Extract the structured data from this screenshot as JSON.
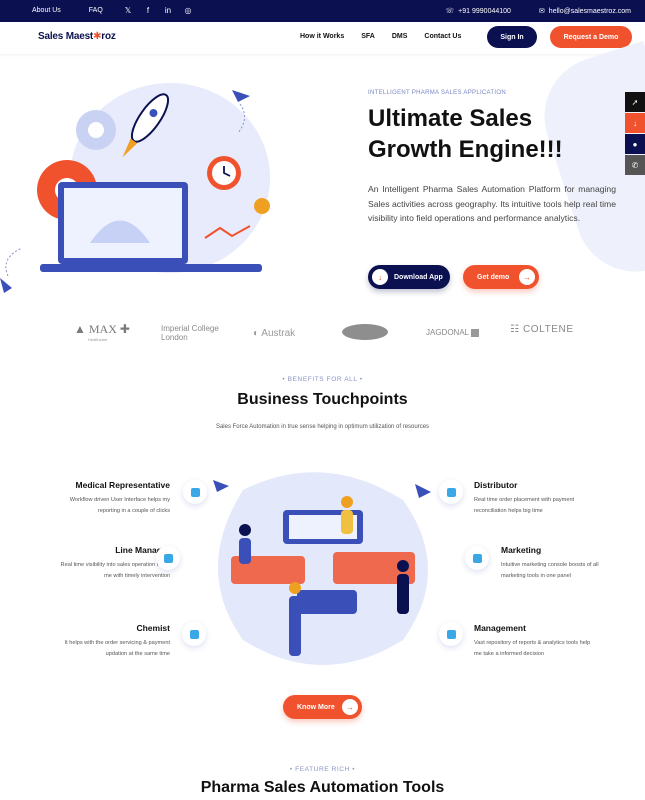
{
  "topbar": {
    "about": "About Us",
    "faq": "FAQ",
    "social": [
      "twitter-icon",
      "facebook-icon",
      "linkedin-icon",
      "instagram-icon"
    ],
    "social_glyphs": [
      "𝕏",
      "f",
      "in",
      "◎"
    ],
    "phone": "+91 9990044100",
    "email": "hello@salesmaestroz.com"
  },
  "nav": {
    "logo_text_1": "Sales Maest",
    "logo_star": "✱",
    "logo_text_2": "roz",
    "links": [
      "How it Works",
      "SFA",
      "DMS",
      "Contact Us"
    ],
    "signin": "Sign In",
    "demo": "Request a Demo"
  },
  "hero": {
    "eyebrow": "INTELLIGENT PHARMA SALES APPLICATION",
    "title": "Ultimate Sales Growth Engine!!!",
    "description": "An Intelligent Pharma Sales Automation Platform for managing Sales activities across geography. Its intuitive tools help real time visibility into field operations and performance analytics.",
    "download_btn": "Download App",
    "getdemo_btn": "Get demo"
  },
  "logos": {
    "max": "MAX",
    "max_sub": "Healthcare",
    "imperial": "Imperial College London",
    "austrak": "Austrak",
    "jagdonal": "JAGDONAL",
    "coltene": "COLTENE"
  },
  "benefits": {
    "eyebrow": "BENEFITS FOR ALL",
    "title": "Business Touchpoints",
    "subtitle": "Sales Force Automation in true sense helping in optimum utilization of resources",
    "items_left": [
      {
        "title": "Medical Representative",
        "desc": "Workflow driven User Interface helps my reporting in a couple of clicks"
      },
      {
        "title": "Line Manager",
        "desc": "Real time visibility into sales operation helps me with timely intervention"
      },
      {
        "title": "Chemist",
        "desc": "It helps with the order servicing & payment updation at the same time"
      }
    ],
    "items_right": [
      {
        "title": "Distributor",
        "desc": "Real time order placement with payment reconciliation helps big time"
      },
      {
        "title": "Marketing",
        "desc": "Intuitive marketing console boosts of all marketing tools in one panel"
      },
      {
        "title": "Management",
        "desc": "Vast repository of reports & analytics tools help me take a informed decision"
      }
    ],
    "know_more": "Know More"
  },
  "features": {
    "eyebrow": "FEATURE RICH",
    "title": "Pharma Sales Automation Tools"
  },
  "colors": {
    "navy": "#0b1150",
    "accent": "#f0522e",
    "light_blue": "#eef0fb"
  }
}
